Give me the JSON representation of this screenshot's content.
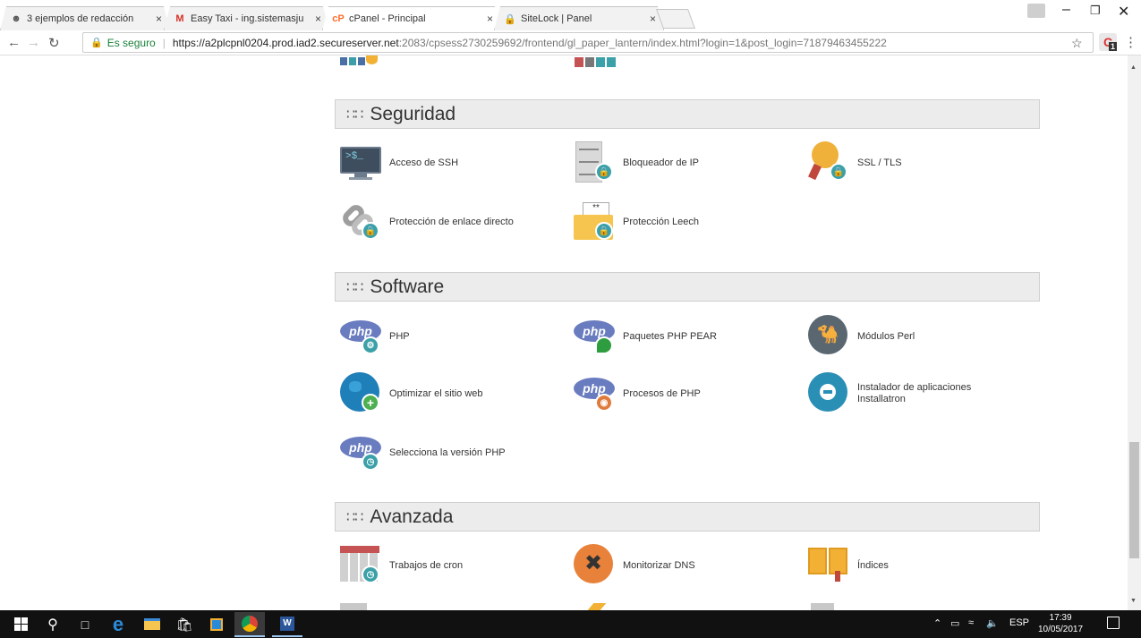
{
  "tabs": [
    {
      "title": "3 ejemplos de redacción",
      "favicon": "snoopy-icon"
    },
    {
      "title": "Easy Taxi - ing.sistemasju",
      "favicon": "gmail-icon"
    },
    {
      "title": "cPanel - Principal",
      "favicon": "cpanel-icon"
    },
    {
      "title": "SiteLock | Panel",
      "favicon": "sitelock-icon"
    }
  ],
  "close_glyph": "×",
  "omnibar": {
    "secure_label": "Es seguro",
    "url_host": "https://a2plcpnl0204.prod.iad2.secureserver.net",
    "url_path": ":2083/cpsess2730259692/frontend/gl_paper_lantern/index.html?login=1&post_login=71879463455222",
    "extension_count": "1"
  },
  "sections": {
    "seguridad": {
      "title": "Seguridad",
      "items": [
        "Acceso de SSH",
        "Bloqueador de IP",
        "SSL / TLS",
        "Protección de enlace directo",
        "Protección Leech"
      ]
    },
    "software": {
      "title": "Software",
      "items": [
        "PHP",
        "Paquetes PHP PEAR",
        "Módulos Perl",
        "Optimizar el sitio web",
        "Procesos de PHP",
        "Instalador de aplicaciones Installatron",
        "Selecciona la versión PHP"
      ]
    },
    "avanzada": {
      "title": "Avanzada",
      "items": [
        "Trabajos de cron",
        "Monitorizar DNS",
        "Índices"
      ]
    }
  },
  "taskbar": {
    "lang": "ESP",
    "time": "17:39",
    "date": "10/05/2017"
  },
  "colors": {
    "php_blue": "#6a7cc0",
    "lock_teal": "#3ba0a8",
    "section_bg": "#ececec"
  }
}
